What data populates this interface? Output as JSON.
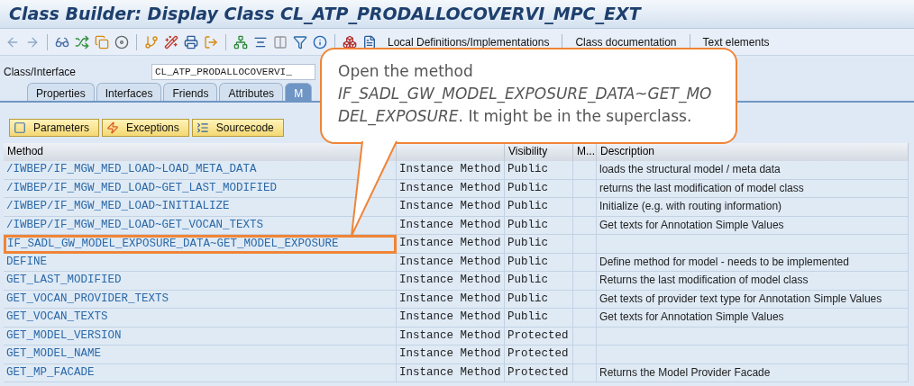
{
  "window": {
    "title": "Class Builder: Display Class CL_ATP_PRODALLOCOVERVI_MPC_EXT"
  },
  "toolbar": {
    "text_buttons": [
      "Local Definitions/Implementations",
      "Class documentation",
      "Text elements"
    ]
  },
  "class_field": {
    "label": "Class/Interface",
    "value": "CL_ATP_PRODALLOCOVERVI_"
  },
  "tabs": [
    {
      "label": "Properties",
      "selected": false
    },
    {
      "label": "Interfaces",
      "selected": false
    },
    {
      "label": "Friends",
      "selected": false
    },
    {
      "label": "Attributes",
      "selected": false
    },
    {
      "label": "M",
      "selected": true
    }
  ],
  "method_buttons": [
    {
      "label": "Parameters",
      "kind": "parameters"
    },
    {
      "label": "Exceptions",
      "kind": "exceptions"
    },
    {
      "label": "Sourcecode",
      "kind": "source"
    }
  ],
  "table": {
    "columns": [
      "Method",
      "Visibility",
      "M...",
      "Description"
    ],
    "rows": [
      {
        "method": "/IWBEP/IF_MGW_MED_LOAD~LOAD_META_DATA",
        "type": "Instance Method",
        "visibility": "Public",
        "description": "loads the structural model / meta data",
        "highlighted": false
      },
      {
        "method": "/IWBEP/IF_MGW_MED_LOAD~GET_LAST_MODIFIED",
        "type": "Instance Method",
        "visibility": "Public",
        "description": "returns the last modification of model class",
        "highlighted": false
      },
      {
        "method": "/IWBEP/IF_MGW_MED_LOAD~INITIALIZE",
        "type": "Instance Method",
        "visibility": "Public",
        "description": "Initialize (e.g. with routing information)",
        "highlighted": false
      },
      {
        "method": "/IWBEP/IF_MGW_MED_LOAD~GET_VOCAN_TEXTS",
        "type": "Instance Method",
        "visibility": "Public",
        "description": "Get texts for Annotation Simple Values",
        "highlighted": false
      },
      {
        "method": "IF_SADL_GW_MODEL_EXPOSURE_DATA~GET_MODEL_EXPOSURE",
        "type": "Instance Method",
        "visibility": "Public",
        "highlighted": true
      },
      {
        "method": "DEFINE",
        "type": "Instance Method",
        "visibility": "Public",
        "description": "Define method for model - needs to be implemented",
        "highlighted": false
      },
      {
        "method": "GET_LAST_MODIFIED",
        "type": "Instance Method",
        "visibility": "Public",
        "description": "Returns the last modification of model class",
        "highlighted": false
      },
      {
        "method": "GET_VOCAN_PROVIDER_TEXTS",
        "type": "Instance Method",
        "visibility": "Public",
        "description": "Get texts of provider text type for Annotation Simple Values",
        "highlighted": false
      },
      {
        "method": "GET_VOCAN_TEXTS",
        "type": "Instance Method",
        "visibility": "Public",
        "description": "Get texts for Annotation Simple Values",
        "highlighted": false
      },
      {
        "method": "GET_MODEL_VERSION",
        "type": "Instance Method",
        "visibility": "Protected",
        "highlighted": false
      },
      {
        "method": "GET_MODEL_NAME",
        "type": "Instance Method",
        "visibility": "Protected",
        "highlighted": false
      },
      {
        "method": "GET_MP_FACADE",
        "type": "Instance Method",
        "visibility": "Protected",
        "description": "Returns the Model Provider Facade",
        "highlighted": false
      }
    ]
  },
  "callout": {
    "text": "Open the method *IF_SADL_GW_MODEL_EXPOSURE_DATA~GET_MO DEL_EXPOSURE*. It might be in the superclass."
  }
}
